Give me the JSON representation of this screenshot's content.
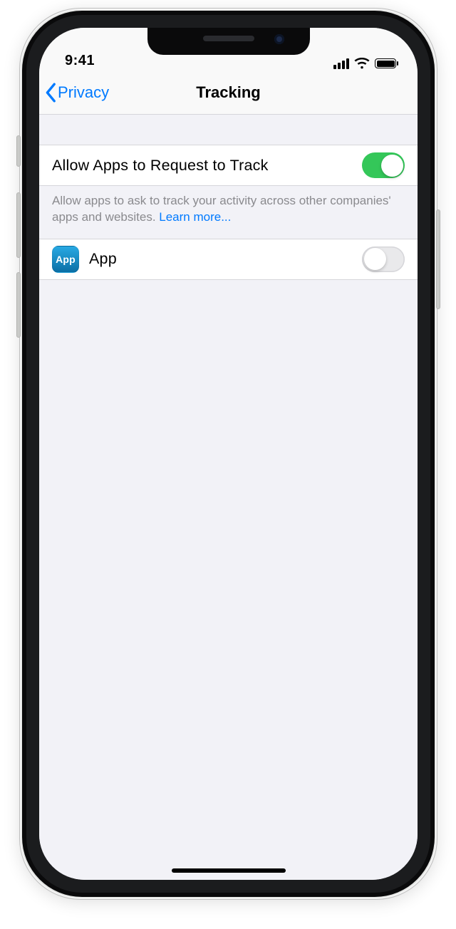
{
  "status": {
    "time": "9:41"
  },
  "nav": {
    "back_label": "Privacy",
    "title": "Tracking"
  },
  "main": {
    "allow_label": "Allow Apps to Request to Track",
    "allow_on": true,
    "footer_text": "Allow apps to ask to track your activity across other companies' apps and websites. ",
    "learn_more": "Learn more...",
    "app": {
      "icon_text": "App",
      "name": "App",
      "on": false
    }
  },
  "colors": {
    "tint": "#007AFF",
    "toggle_on": "#34C759",
    "grouped_bg": "#F2F2F7"
  }
}
